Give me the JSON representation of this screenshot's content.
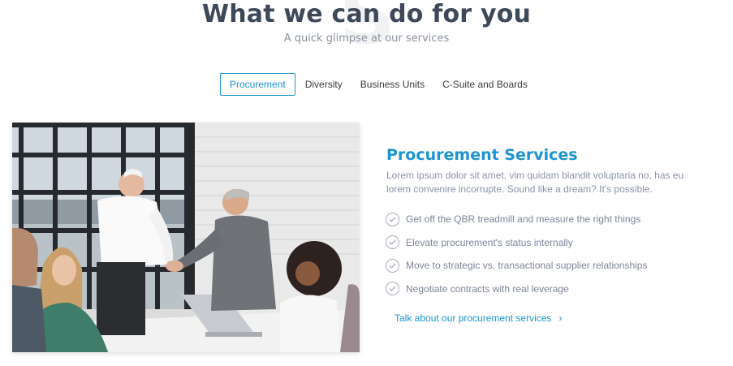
{
  "header": {
    "watermark": "S",
    "title": "What we can do for you",
    "subtitle": "A quick glimpse at our services"
  },
  "tabs": [
    {
      "label": "Procurement",
      "active": true
    },
    {
      "label": "Diversity",
      "active": false
    },
    {
      "label": "Business Units",
      "active": false
    },
    {
      "label": "C-Suite and Boards",
      "active": false
    }
  ],
  "service": {
    "title": "Procurement Services",
    "description": "Lorem ipsum dolor sit amet, vim quidam blandit voluptaria no, has eu lorem convenire incorrupte. Sound like a dream? It's possible.",
    "features": [
      "Get off the QBR treadmill and measure the right things",
      "Elevate procurement's status internally",
      "Move to strategic vs. transactional supplier relationships",
      "Negotiate contracts with real leverage"
    ],
    "cta_label": "Talk about our procurement services",
    "cta_icon": "chevron-right-icon"
  },
  "image": {
    "subject": "business-meeting-handshake-photo"
  },
  "colors": {
    "accent": "#1c94d2",
    "heading": "#3d4858",
    "muted": "#8a93a7"
  }
}
